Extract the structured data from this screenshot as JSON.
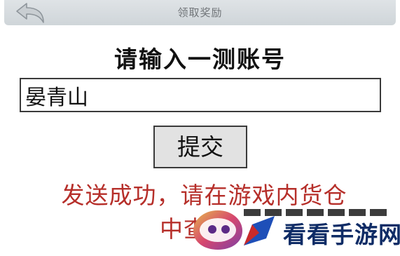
{
  "header": {
    "title": "领取奖励",
    "back_icon": "back-arrow-icon"
  },
  "form": {
    "prompt": "请输入一测账号",
    "account_value": "晏青山",
    "submit_label": "提交"
  },
  "result": {
    "line1": "发送成功，请在游戏内货仓",
    "line2": "中查收"
  },
  "watermark": {
    "text": "看看手游网"
  },
  "colors": {
    "header_bg": "#d5dadd",
    "header_text": "#707478",
    "result_text": "#b62f2a",
    "button_bg": "#e2e2e2",
    "watermark_text": "#0f2c66"
  }
}
